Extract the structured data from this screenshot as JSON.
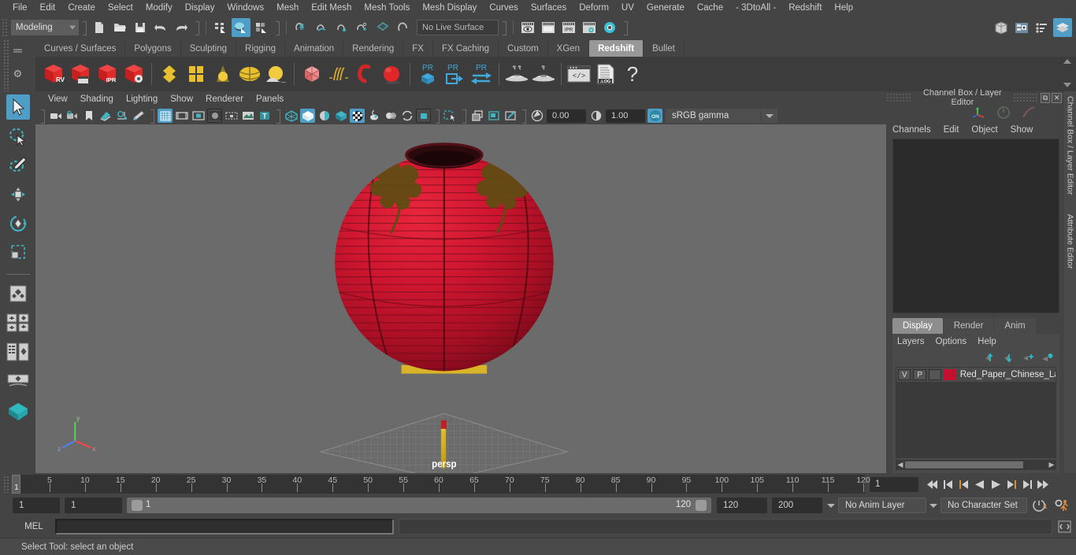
{
  "menubar": {
    "items": [
      "File",
      "Edit",
      "Create",
      "Select",
      "Modify",
      "Display",
      "Windows",
      "Mesh",
      "Edit Mesh",
      "Mesh Tools",
      "Mesh Display",
      "Curves",
      "Surfaces",
      "Deform",
      "UV",
      "Generate",
      "Cache",
      "- 3DtoAll -",
      "Redshift",
      "Help"
    ]
  },
  "statusline": {
    "menuset_value": "Modeling",
    "live_surface": "No Live Surface",
    "icons": [
      "new-scene-icon",
      "open-scene-icon",
      "save-scene-icon",
      "undo-icon",
      "redo-icon",
      "select-by-hierarchy-icon",
      "select-by-object-icon",
      "select-by-component-icon",
      "snap-to-grid-icon",
      "snap-to-curve-icon",
      "snap-to-point-icon",
      "snap-to-projected-center-icon",
      "snap-to-view-plane-icon",
      "make-live-icon",
      "render-current-frame-icon",
      "ipr-render-icon",
      "render-settings-icon",
      "hypershade-icon",
      "render-view-icon"
    ],
    "right_icons": [
      "show-hide-modeling-toolkit-icon",
      "show-hide-attribute-editor-icon",
      "show-hide-tool-settings-icon",
      "show-hide-channel-box-icon"
    ]
  },
  "shelf": {
    "tabs": [
      "Curves / Surfaces",
      "Polygons",
      "Sculpting",
      "Rigging",
      "Animation",
      "Rendering",
      "FX",
      "FX Caching",
      "Custom",
      "XGen",
      "Redshift",
      "Bullet"
    ],
    "active_tab": "Redshift",
    "buttons": [
      "redshift-rv-icon",
      "redshift-render-sequence-icon",
      "redshift-ipr-icon",
      "redshift-render-settings-icon",
      "redshift-material-icon",
      "redshift-matte-icon",
      "redshift-light-cone-icon",
      "redshift-dome-light-icon",
      "redshift-area-light-icon",
      "redshift-proxy-icon",
      "redshift-hair-icon",
      "redshift-volume-icon",
      "redshift-sphere-icon",
      "redshift-pr-object-icon",
      "redshift-pr-export-icon",
      "redshift-pr-swap-icon",
      "redshift-bake-icon",
      "redshift-bake-alt-icon",
      "redshift-script-icon",
      "redshift-log-icon",
      "redshift-help-icon"
    ]
  },
  "toolbox": {
    "tools": [
      "select-tool-icon",
      "lasso-select-tool-icon",
      "paint-select-tool-icon",
      "move-tool-icon",
      "rotate-tool-icon",
      "scale-tool-icon",
      "last-tool-icon",
      "snap-align-icon",
      "multi-cut-icon",
      "show-manipulator-icon",
      "outliner-view-icon",
      "hypergraph-view-icon",
      "persp-view-icon"
    ],
    "active": "select-tool-icon"
  },
  "viewport": {
    "menus": [
      "View",
      "Shading",
      "Lighting",
      "Show",
      "Renderer",
      "Panels"
    ],
    "toolbar_icons": [
      "select-camera-icon",
      "camera-attributes-icon",
      "bookmark-icon",
      "image-plane-icon",
      "two-d-pan-zoom-icon",
      "grease-pencil-icon",
      "grid-toggle-icon",
      "film-gate-icon",
      "resolution-gate-icon",
      "gate-mask-icon",
      "film-origin-icon",
      "exposure-icon",
      "xray-icon",
      "wireframe-icon",
      "smooth-shade-icon",
      "shaded-textured-icon",
      "use-default-material-icon",
      "xray-joints-icon",
      "xray-active-components-icon",
      "lights-toggle-icon",
      "shadows-icon",
      "ao-icon",
      "motion-blur-icon",
      "multisample-icon",
      "isolate-select-icon",
      "image-based-lighting-icon",
      "viewport-snapshot-icon",
      "grab-icon"
    ],
    "exposure_value": "0.00",
    "gamma_value": "1.00",
    "color_space": "sRGB gamma",
    "camera_label": "persp",
    "background_color": "#6b6b6b",
    "lantern_color": "#c81225"
  },
  "right_dock": {
    "panel_title": "Channel Box / Layer Editor",
    "side_labels": [
      "Channel Box / Layer Editor",
      "Attribute Editor"
    ],
    "channelbox_menus": [
      "Channels",
      "Edit",
      "Object",
      "Show"
    ],
    "layer_tabs": [
      "Display",
      "Render",
      "Anim"
    ],
    "layer_tab_active": "Display",
    "layer_menus": [
      "Layers",
      "Options",
      "Help"
    ],
    "layer_buttons": [
      "move-layer-up-icon",
      "move-layer-down-icon",
      "new-layer-icon",
      "new-layer-from-selected-icon"
    ],
    "layers": [
      {
        "visibility": "V",
        "playback": "P",
        "shading": "",
        "color": "#c4102f",
        "name": "Red_Paper_Chinese_La"
      }
    ]
  },
  "timeline": {
    "start": 1,
    "end": 120,
    "tick_step": 5,
    "labels": [
      5,
      10,
      15,
      20,
      25,
      30,
      35,
      40,
      45,
      50,
      55,
      60,
      65,
      70,
      75,
      80,
      85,
      90,
      95,
      100,
      105,
      110,
      115,
      120
    ],
    "current_frame": "1",
    "current_frame_field": "1",
    "playback_buttons": [
      "go-to-start-icon",
      "step-back-keyframe-icon",
      "step-back-frame-icon",
      "play-backward-icon",
      "play-forward-icon",
      "step-forward-frame-icon",
      "step-forward-keyframe-icon",
      "go-to-end-icon"
    ]
  },
  "range": {
    "anim_start": "1",
    "range_start": "1",
    "slider_left_value": "1",
    "slider_right_value": "120",
    "range_end": "120",
    "anim_end": "200",
    "anim_layer": "No Anim Layer",
    "character_set": "No Character Set",
    "right_icons": [
      "auto-keyframe-icon",
      "animation-preferences-icon"
    ]
  },
  "command": {
    "language_label": "MEL",
    "input_value": "",
    "input_placeholder": "",
    "output_value": "",
    "script_editor_icon": "script-editor-icon"
  },
  "statusbar": {
    "help_text": "Select Tool: select an object"
  }
}
